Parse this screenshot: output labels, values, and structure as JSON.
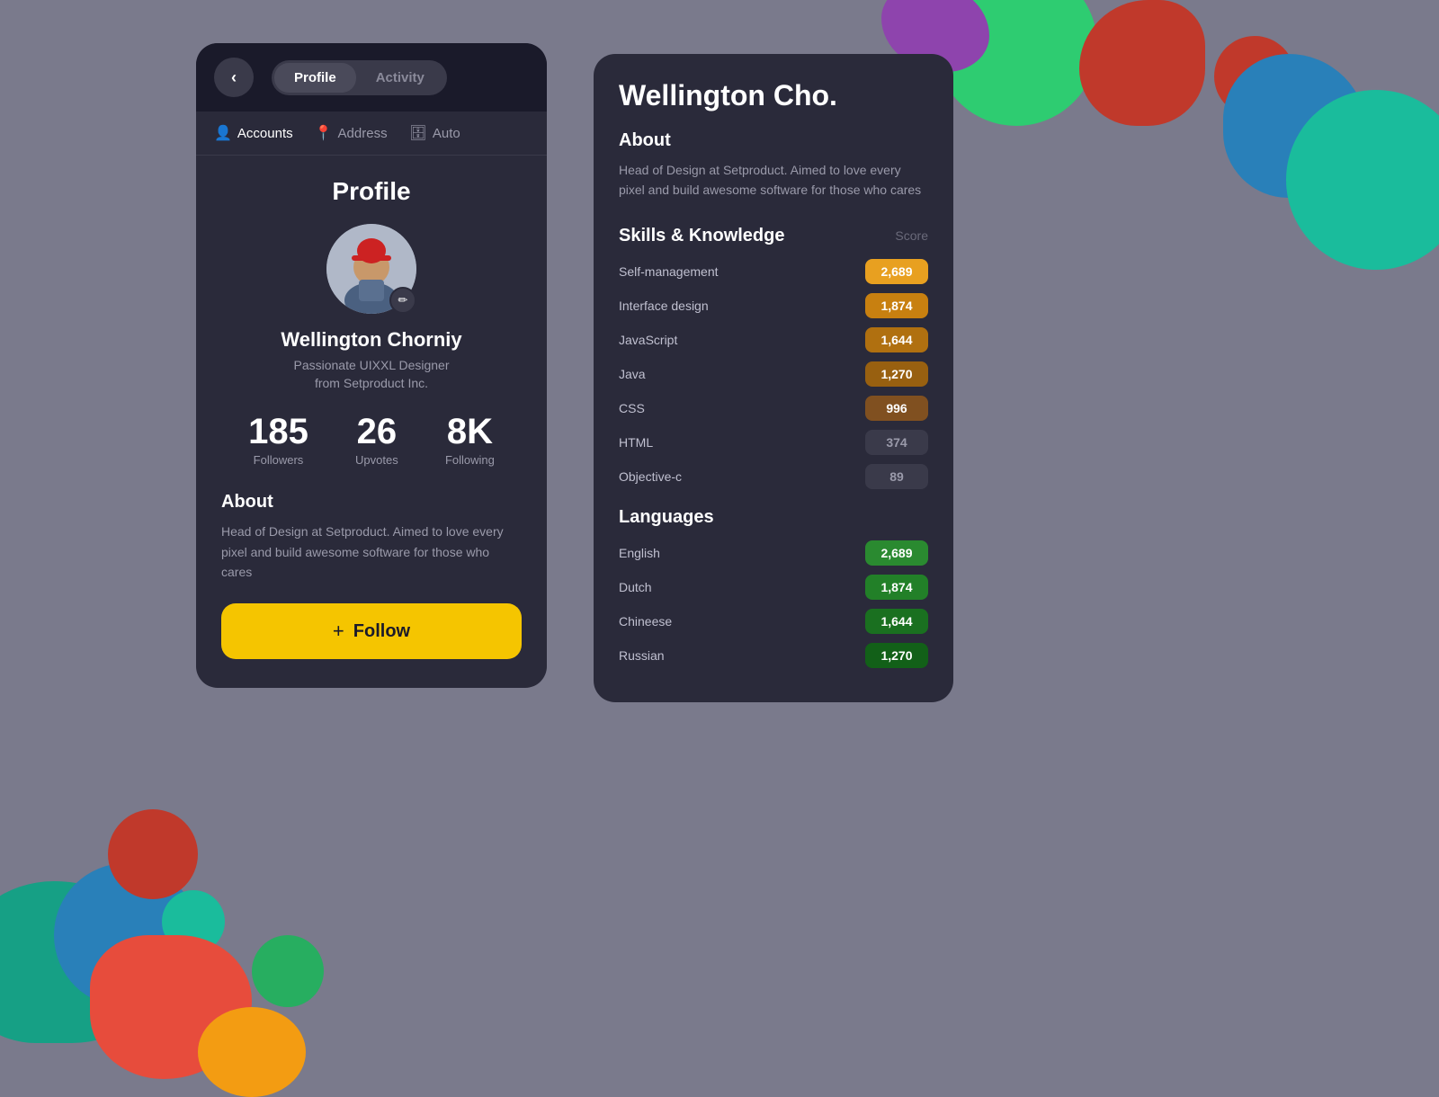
{
  "background": "#7a7a8c",
  "profile": {
    "header": {
      "back_label": "‹",
      "tab_profile": "Profile",
      "tab_activity": "Activity"
    },
    "subnav": {
      "accounts": "Accounts",
      "address": "Address",
      "auto": "Auto"
    },
    "title": "Profile",
    "user": {
      "name": "Wellington Chorniy",
      "bio_line1": "Passionate UIXXL Designer",
      "bio_line2": "from Setproduct Inc."
    },
    "stats": {
      "followers_num": "185",
      "followers_label": "Followers",
      "upvotes_num": "26",
      "upvotes_label": "Upvotes",
      "following_num": "8K",
      "following_label": "Following"
    },
    "about": {
      "title": "About",
      "text": "Head of Design at Setproduct. Aimed to love every pixel and build awesome software for those who cares"
    },
    "follow_button": {
      "plus": "+",
      "label": "Follow"
    }
  },
  "detail": {
    "name": "Wellington Cho.",
    "about": {
      "title": "About",
      "text": "Head of Design at Setproduct. Aimed to love every pixel and build awesome software for those who cares"
    },
    "skills": {
      "title": "Skills & Knowledge",
      "score_label": "Score",
      "items": [
        {
          "name": "Self-management",
          "score": "2,689",
          "color_class": "score-gold-1"
        },
        {
          "name": "Interface design",
          "score": "1,874",
          "color_class": "score-gold-2"
        },
        {
          "name": "JavaScript",
          "score": "1,644",
          "color_class": "score-gold-3"
        },
        {
          "name": "Java",
          "score": "1,270",
          "color_class": "score-gold-4"
        },
        {
          "name": "CSS",
          "score": "996",
          "color_class": "score-gold-5"
        },
        {
          "name": "HTML",
          "score": "374",
          "color_class": "score-gray"
        },
        {
          "name": "Objective-c",
          "score": "89",
          "color_class": "score-gray"
        }
      ]
    },
    "languages": {
      "title": "Languages",
      "items": [
        {
          "name": "English",
          "score": "2,689",
          "color_class": "lang-score-green"
        },
        {
          "name": "Dutch",
          "score": "1,874",
          "color_class": "lang-score-green-2"
        },
        {
          "name": "Chineese",
          "score": "1,644",
          "color_class": "lang-score-green-3"
        },
        {
          "name": "Russian",
          "score": "1,270",
          "color_class": "lang-score-green-4"
        }
      ]
    }
  }
}
